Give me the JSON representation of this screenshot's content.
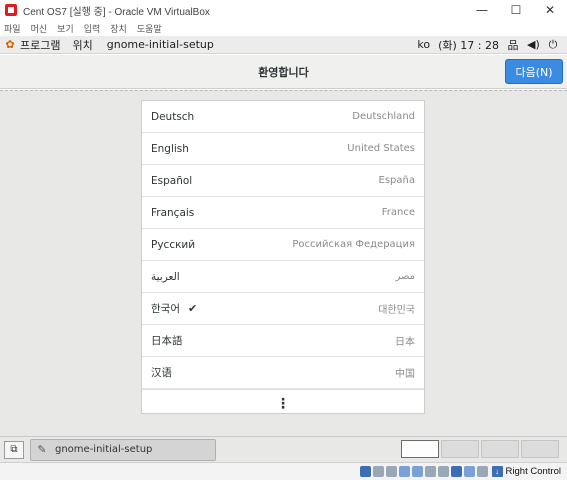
{
  "window": {
    "title": "Cent OS7 [실행 중] - Oracle VM VirtualBox",
    "minimize_glyph": "—",
    "maximize_glyph": "☐",
    "close_glyph": "✕"
  },
  "vbox_menu": [
    "파일",
    "머신",
    "보기",
    "입력",
    "장치",
    "도움말"
  ],
  "gnome_top": {
    "apps": "프로그램",
    "places": "위치",
    "app_name": "gnome-initial-setup",
    "input_method": "ko",
    "clock": "(화) 17 : 28",
    "network_glyph": "品",
    "volume_glyph": "◀)",
    "power_glyph": "⏻"
  },
  "header": {
    "title": "환영합니다",
    "next_label": "다음(N)"
  },
  "languages": [
    {
      "name": "Deutsch",
      "region": "Deutschland",
      "selected": false
    },
    {
      "name": "English",
      "region": "United States",
      "selected": false
    },
    {
      "name": "Español",
      "region": "España",
      "selected": false
    },
    {
      "name": "Français",
      "region": "France",
      "selected": false
    },
    {
      "name": "Русский",
      "region": "Российская Федерация",
      "selected": false
    },
    {
      "name": "العربية",
      "region": "مصر",
      "selected": false
    },
    {
      "name": "한국어",
      "region": "대한민국",
      "selected": true
    },
    {
      "name": "日本語",
      "region": "日本",
      "selected": false
    },
    {
      "name": "汉语",
      "region": "中国",
      "selected": false
    }
  ],
  "more_glyph": "⋮",
  "check_glyph": "✔",
  "taskbar": {
    "task_label": "gnome-initial-setup",
    "workspace_count": 4,
    "active_workspace": 1
  },
  "statusbar": {
    "host_key": "Right Control"
  },
  "colors": {
    "accent": "#3c8be2",
    "header_bg": "#f0f0ef",
    "content_bg": "#e8e8e7"
  }
}
